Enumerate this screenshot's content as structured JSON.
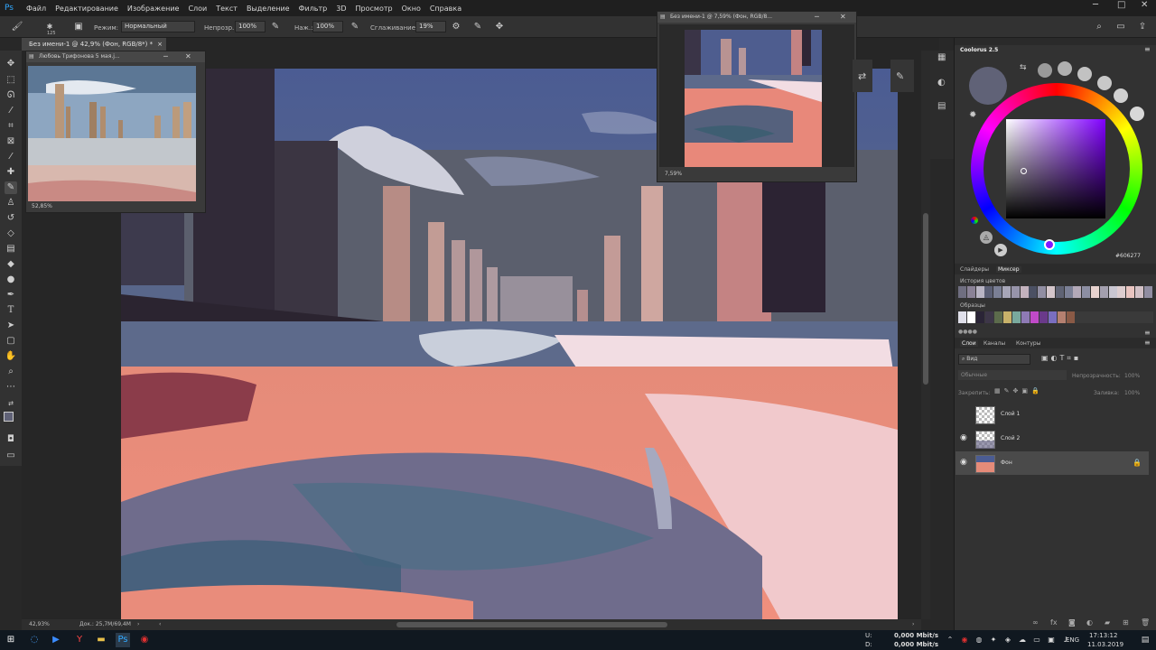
{
  "app": {
    "logo": "Ps"
  },
  "menu": {
    "items": [
      "Файл",
      "Редактирование",
      "Изображение",
      "Слои",
      "Текст",
      "Выделение",
      "Фильтр",
      "3D",
      "Просмотр",
      "Окно",
      "Справка"
    ]
  },
  "options": {
    "brush_size": "125",
    "mode_label": "Режим:",
    "mode_value": "Нормальный",
    "opacity_label": "Непрозр.:",
    "opacity_value": "100%",
    "pressure_label": "Наж.:",
    "pressure_value": "100%",
    "smoothing_label": "Сглаживание:",
    "smoothing_value": "19%"
  },
  "document": {
    "tab_title": "Без имени-1 @ 42,9% (Фон, RGB/8*) *",
    "zoom": "42,93%",
    "doc_size": "Док.: 25,7M/69,4M"
  },
  "reference_window": {
    "title": "Любовь Трифонова 5 мая.j...",
    "zoom": "52,85%"
  },
  "navigator_window": {
    "title": "Без имени-1 @ 7,59% (Фон, RGB/8...",
    "zoom": "7,59%"
  },
  "coolorus": {
    "title": "Coolorus 2.5",
    "current_color": "#606277",
    "hex": "606277",
    "tabs": [
      "Слайдеры",
      "Миксер"
    ],
    "active_tab": "Миксер",
    "history_label": "История цветов",
    "swatches_label": "Образцы",
    "history_colors": [
      "#6f6e80",
      "#8a8296",
      "#b9b5c4",
      "#5b5f75",
      "#7a7f95",
      "#a7a6b8",
      "#9794aa",
      "#c3b2bd",
      "#4b5063",
      "#918ea2",
      "#d4c6cb",
      "#5f6374",
      "#7b8096",
      "#b3a9b8",
      "#8c8ea2",
      "#e8d3cf",
      "#a39fae",
      "#c9c6d1",
      "#ddcdcf",
      "#e9c4c0",
      "#d2c0c6",
      "#908da1"
    ],
    "swatch_colors": [
      "#e0e0ea",
      "#ffffff",
      "#2a2436",
      "#3d3648",
      "#5c6b4c",
      "#c8b26a",
      "#79a99d",
      "#8e7ab5",
      "#c04ac8",
      "#6a3a8a",
      "#7a6ec0",
      "#b58070",
      "#8a5a46"
    ]
  },
  "layers_panel": {
    "tabs": [
      "Слои",
      "Каналы",
      "Контуры"
    ],
    "active_tab": "Слои",
    "filter_label": "Вид",
    "blend_mode": "Обычные",
    "opacity_label": "Непрозрачность:",
    "opacity_value": "100%",
    "lock_label": "Закрепить:",
    "fill_label": "Заливка:",
    "fill_value": "100%",
    "layers": [
      {
        "name": "Слой 1",
        "visible": false
      },
      {
        "name": "Слой 2",
        "visible": true
      },
      {
        "name": "Фон",
        "visible": true,
        "selected": true,
        "locked": true
      }
    ]
  },
  "taskbar": {
    "net_up_label": "U:",
    "net_down_label": "D:",
    "net_up": "0,000 Mbit/s",
    "net_down": "0,000 Mbit/s",
    "lang": "ENG",
    "time": "17:13:12",
    "date": "11.03.2019"
  }
}
